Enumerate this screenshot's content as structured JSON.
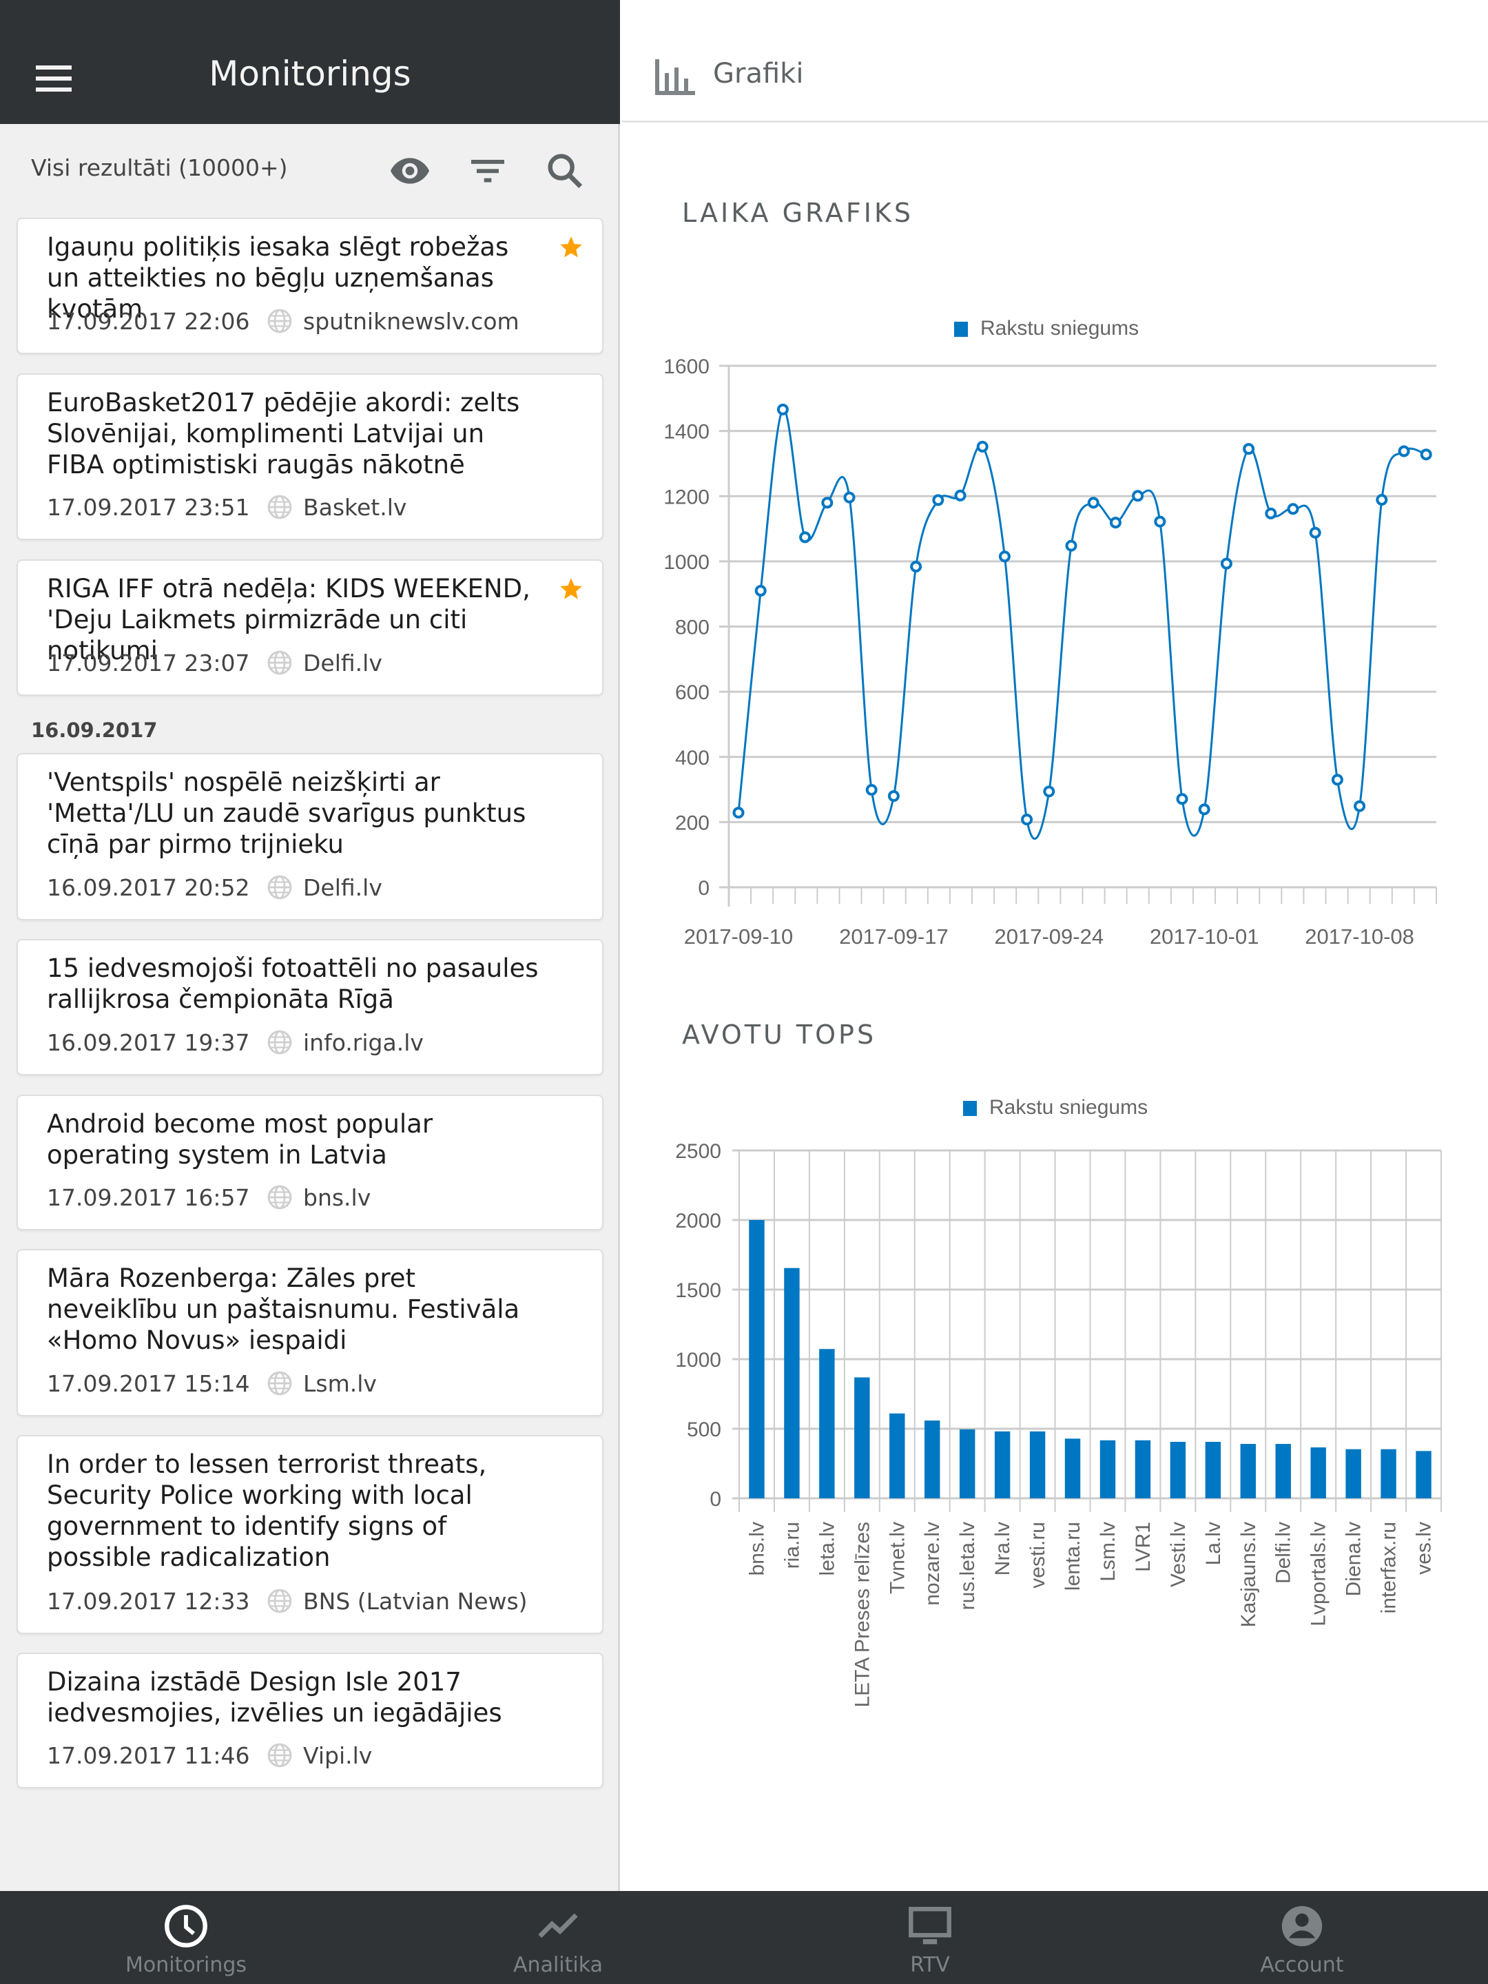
{
  "header": {
    "title": "Monitorings",
    "results_label": "Visi rezultāti (10000+)",
    "icons": [
      "menu-icon",
      "eye-icon",
      "filter-icon",
      "search-icon"
    ]
  },
  "feed": {
    "date_separator": "16.09.2017",
    "items": [
      {
        "title": "Igauņu politiķis iesaka slēgt robežas un atteikties no bēgļu uzņemšanas kvotām",
        "time": "17.09.2017 22:06",
        "source": "sputniknewslv.com",
        "starred": true
      },
      {
        "title": "EuroBasket2017 pēdējie akordi: zelts Slovēnijai, komplimenti Latvijai un FIBA optimistiski raugās nākotnē",
        "time": "17.09.2017 23:51",
        "source": "Basket.lv",
        "starred": false
      },
      {
        "title": "RIGA IFF otrā nedēļa: KIDS WEEKEND, 'Deju Laikmets pirmizrāde un citi notikumi",
        "time": "17.09.2017 23:07",
        "source": "Delfi.lv",
        "starred": true
      },
      {
        "title": "'Ventspils' nospēlē neizšķirti ar 'Metta'/LU un zaudē svarīgus punktus cīņā par pirmo trijnieku",
        "time": "16.09.2017 20:52",
        "source": "Delfi.lv",
        "starred": false
      },
      {
        "title": "15 iedvesmojoši fotoattēli no pasaules rallijkrosa čempionāta Rīgā",
        "time": "16.09.2017 19:37",
        "source": "info.riga.lv",
        "starred": false
      },
      {
        "title": "Android become most popular operating system in Latvia",
        "time": "17.09.2017 16:57",
        "source": "bns.lv",
        "starred": false
      },
      {
        "title": "Māra Rozenberga: Zāles pret neveiklību un paštaisnumu. Festivāla «Homo Novus» iespaidi",
        "time": "17.09.2017 15:14",
        "source": "Lsm.lv",
        "starred": false
      },
      {
        "title": "In order to lessen terrorist threats, Security Police working with local government to identify signs of possible radicalization",
        "time": "17.09.2017 12:33",
        "source": "BNS (Latvian News)",
        "starred": false
      },
      {
        "title": "Dizaina izstādē Design Isle 2017 iedvesmojies, izvēlies un iegādājies",
        "time": "17.09.2017 11:46",
        "source": "Vipi.lv",
        "starred": false
      }
    ]
  },
  "right_panel": {
    "title": "Grafiki",
    "section_time": "LAIKA GRAFIKS",
    "section_sources": "AVOTU TOPS"
  },
  "colors": {
    "series": "#0077c2",
    "star": "#ffa000",
    "dark_bar": "#2f3336",
    "grid": "#cccccc",
    "axis_text": "#666666"
  },
  "chart_data": [
    {
      "type": "line",
      "title": "LAIKA GRAFIKS",
      "legend": [
        "Rakstu sniegums"
      ],
      "legend_position": "top-center",
      "xlabel": "",
      "ylabel": "",
      "ylim": [
        0,
        1600
      ],
      "yticks": [
        0,
        200,
        400,
        600,
        800,
        1000,
        1200,
        1400,
        1600
      ],
      "xtick_labels": [
        "2017-09-10",
        "2017-09-17",
        "2017-09-24",
        "2017-10-01",
        "2017-10-08"
      ],
      "grid": true,
      "x": [
        "2017-09-10",
        "2017-09-11",
        "2017-09-12",
        "2017-09-13",
        "2017-09-14",
        "2017-09-15",
        "2017-09-16",
        "2017-09-17",
        "2017-09-18",
        "2017-09-19",
        "2017-09-20",
        "2017-09-21",
        "2017-09-22",
        "2017-09-23",
        "2017-09-24",
        "2017-09-25",
        "2017-09-26",
        "2017-09-27",
        "2017-09-28",
        "2017-09-29",
        "2017-09-30",
        "2017-10-01",
        "2017-10-02",
        "2017-10-03",
        "2017-10-04",
        "2017-10-05",
        "2017-10-06",
        "2017-10-07",
        "2017-10-08",
        "2017-10-09",
        "2017-10-10",
        "2017-10-11"
      ],
      "series": [
        {
          "name": "Rakstu sniegums",
          "values": [
            229,
            910,
            1466,
            1074,
            1180,
            1196,
            299,
            280,
            984,
            1188,
            1202,
            1352,
            1015,
            208,
            294,
            1048,
            1180,
            1119,
            1201,
            1122,
            271,
            239,
            993,
            1345,
            1147,
            1161,
            1088,
            330,
            249,
            1189,
            1338,
            1328
          ]
        }
      ]
    },
    {
      "type": "bar",
      "title": "AVOTU TOPS",
      "legend": [
        "Rakstu sniegums"
      ],
      "legend_position": "top-center",
      "xlabel": "",
      "ylabel": "",
      "ylim": [
        0,
        2500
      ],
      "yticks": [
        0,
        500,
        1000,
        1500,
        2000,
        2500
      ],
      "grid": true,
      "categories": [
        "bns.lv",
        "ria.ru",
        "leta.lv",
        "LETA Preses relīzes",
        "Tvnet.lv",
        "nozare.lv",
        "rus.leta.lv",
        "Nra.lv",
        "vesti.ru",
        "lenta.ru",
        "Lsm.lv",
        "LVR1",
        "Vesti.lv",
        "La.lv",
        "Kasjauns.lv",
        "Delfi.lv",
        "Lvportals.lv",
        "Diena.lv",
        "interfax.ru",
        "ves.lv"
      ],
      "series": [
        {
          "name": "Rakstu sniegums",
          "values": [
            2000,
            1655,
            1073,
            869,
            610,
            559,
            496,
            481,
            481,
            429,
            417,
            417,
            406,
            406,
            391,
            391,
            366,
            353,
            353,
            340
          ]
        }
      ]
    }
  ],
  "bottom_nav": {
    "items": [
      {
        "label": "Monitorings",
        "icon": "clock-icon",
        "active": true
      },
      {
        "label": "Analitika",
        "icon": "trending-icon",
        "active": false
      },
      {
        "label": "RTV",
        "icon": "tv-icon",
        "active": false
      },
      {
        "label": "Account",
        "icon": "account-icon",
        "active": false
      }
    ]
  }
}
